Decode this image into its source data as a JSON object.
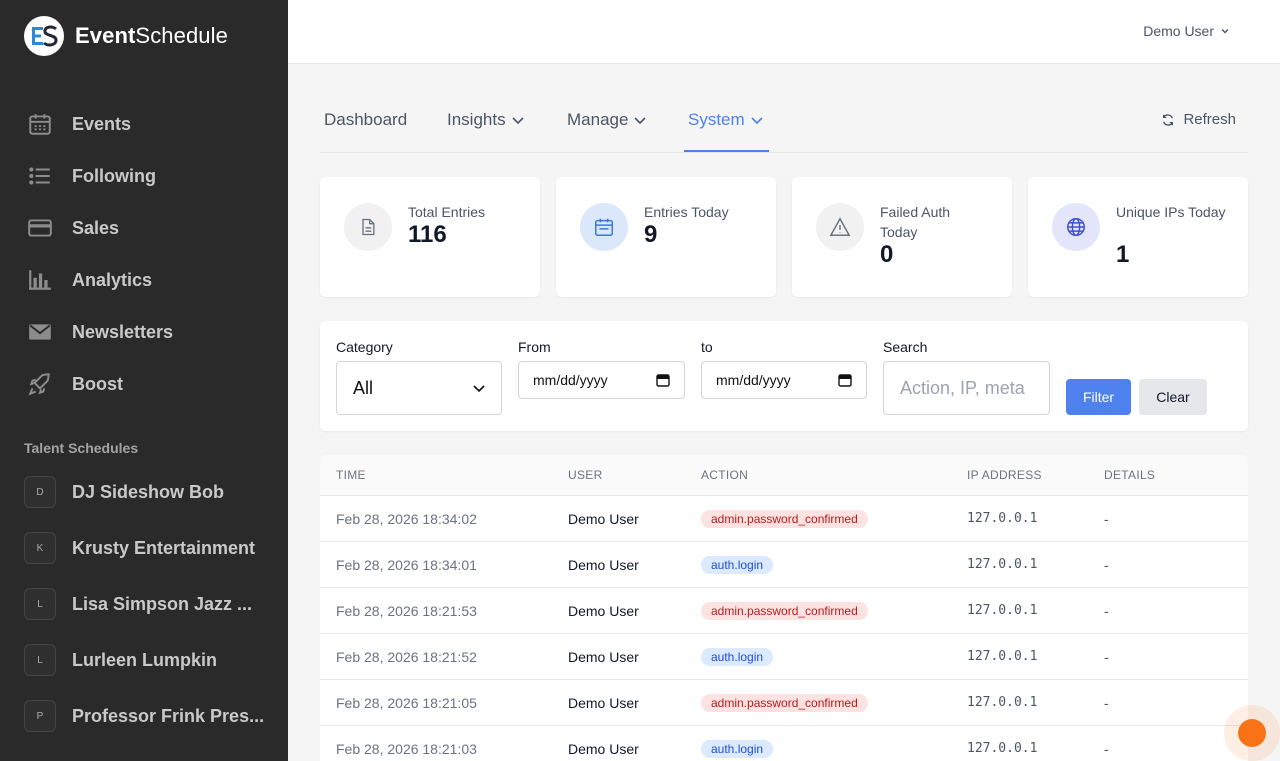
{
  "brand": {
    "name_bold": "Event",
    "name_rest": "Schedule"
  },
  "sidebar": {
    "items": [
      {
        "label": "Events",
        "icon": "calendar-icon"
      },
      {
        "label": "Following",
        "icon": "list-icon"
      },
      {
        "label": "Sales",
        "icon": "credit-card-icon"
      },
      {
        "label": "Analytics",
        "icon": "bar-chart-icon"
      },
      {
        "label": "Newsletters",
        "icon": "envelope-icon"
      },
      {
        "label": "Boost",
        "icon": "rocket-icon"
      }
    ],
    "talent_title": "Talent Schedules",
    "talent": [
      {
        "initial": "D",
        "name": "DJ Sideshow Bob"
      },
      {
        "initial": "K",
        "name": "Krusty Entertainment"
      },
      {
        "initial": "L",
        "name": "Lisa Simpson Jazz ..."
      },
      {
        "initial": "L",
        "name": "Lurleen Lumpkin"
      },
      {
        "initial": "P",
        "name": "Professor Frink Pres..."
      }
    ]
  },
  "header": {
    "user": "Demo User"
  },
  "tabs": {
    "dashboard": "Dashboard",
    "insights": "Insights",
    "manage": "Manage",
    "system": "System",
    "refresh": "Refresh"
  },
  "stats": [
    {
      "label": "Total Entries",
      "value": "116",
      "icon": "document-icon"
    },
    {
      "label": "Entries Today",
      "value": "9",
      "icon": "calendar-icon"
    },
    {
      "label": "Failed Auth Today",
      "value": "0",
      "icon": "warning-icon"
    },
    {
      "label": "Unique IPs Today",
      "value": "1",
      "icon": "globe-icon"
    }
  ],
  "filters": {
    "category_label": "Category",
    "category_value": "All",
    "from_label": "From",
    "from_value": "mm/dd/yyyy",
    "to_label": "to",
    "to_value": "mm/dd/yyyy",
    "search_label": "Search",
    "search_placeholder": "Action, IP, meta",
    "filter_btn": "Filter",
    "clear_btn": "Clear"
  },
  "table": {
    "headers": [
      "TIME",
      "USER",
      "ACTION",
      "IP ADDRESS",
      "DETAILS"
    ],
    "rows": [
      {
        "time": "Feb 28, 2026 18:34:02",
        "user": "Demo User",
        "action": "admin.password_confirmed",
        "tone": "red",
        "ip": "127.0.0.1",
        "details": "-"
      },
      {
        "time": "Feb 28, 2026 18:34:01",
        "user": "Demo User",
        "action": "auth.login",
        "tone": "blue",
        "ip": "127.0.0.1",
        "details": "-"
      },
      {
        "time": "Feb 28, 2026 18:21:53",
        "user": "Demo User",
        "action": "admin.password_confirmed",
        "tone": "red",
        "ip": "127.0.0.1",
        "details": "-"
      },
      {
        "time": "Feb 28, 2026 18:21:52",
        "user": "Demo User",
        "action": "auth.login",
        "tone": "blue",
        "ip": "127.0.0.1",
        "details": "-"
      },
      {
        "time": "Feb 28, 2026 18:21:05",
        "user": "Demo User",
        "action": "admin.password_confirmed",
        "tone": "red",
        "ip": "127.0.0.1",
        "details": "-"
      },
      {
        "time": "Feb 28, 2026 18:21:03",
        "user": "Demo User",
        "action": "auth.login",
        "tone": "blue",
        "ip": "127.0.0.1",
        "details": "-"
      }
    ]
  },
  "colors": {
    "accent": "#4e81ee",
    "sidebar_bg": "#2a2a2a",
    "badge_red": "#b91c1c",
    "badge_blue": "#1d4ed8",
    "fab": "#f97316"
  }
}
